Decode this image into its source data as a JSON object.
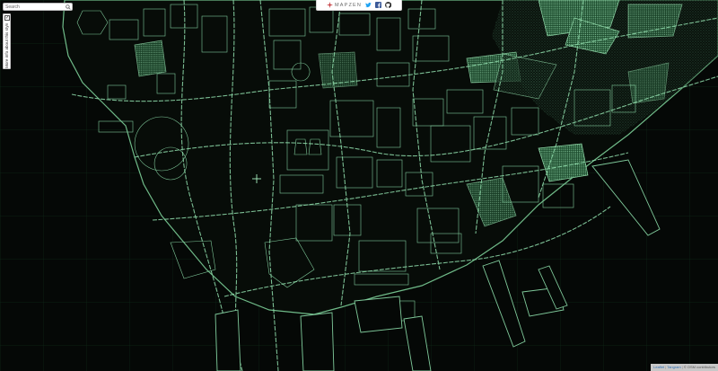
{
  "search": {
    "placeholder": "Search"
  },
  "sidebar": {
    "checkbox_glyph": "✓",
    "label": "More info about this style"
  },
  "topbar": {
    "brand": "MAPZEN",
    "icons": [
      "mapzen-logo-icon",
      "twitter-icon",
      "facebook-icon",
      "github-icon"
    ]
  },
  "attribution": {
    "leaflet": "Leaflet",
    "tangram": "Tangram",
    "copyright": "© OSM contributors"
  },
  "colors": {
    "background": "#050806",
    "grid": "#0f2a1a",
    "linework": "#7fc99a",
    "highlight": "#3f8f5a",
    "twitter": "#1da1f2",
    "facebook": "#3b5998",
    "github": "#222222"
  }
}
